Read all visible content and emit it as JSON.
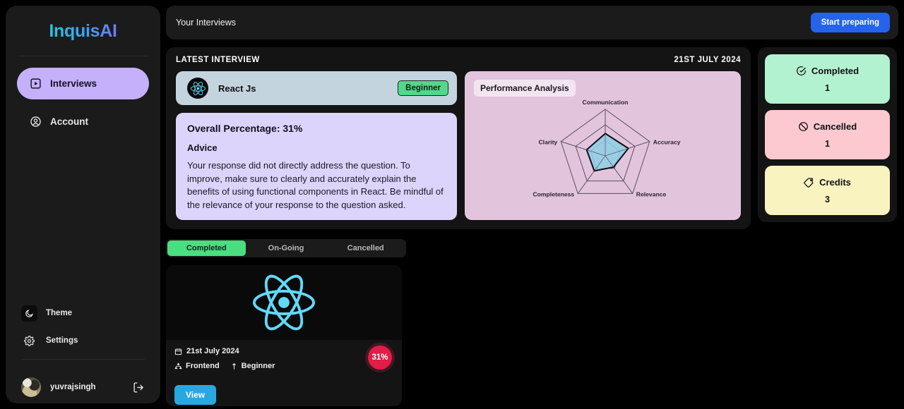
{
  "sidebar": {
    "logo": "InquisAI",
    "nav": [
      {
        "label": "Interviews",
        "icon": "play-square-icon",
        "active": true
      },
      {
        "label": "Account",
        "icon": "user-circle-icon",
        "active": false
      }
    ],
    "theme": {
      "label": "Theme",
      "icon": "moon-icon"
    },
    "settings": {
      "label": "Settings",
      "icon": "gear-icon"
    },
    "user": {
      "name": "yuvrajsingh",
      "logout_icon": "logout-icon",
      "avatar": "user-avatar"
    }
  },
  "header": {
    "title": "Your Interviews",
    "start_button": "Start preparing"
  },
  "latest": {
    "label": "LATEST INTERVIEW",
    "date": "21ST JULY 2024",
    "tech": {
      "name": "React Js",
      "icon": "react-icon",
      "level": "Beginner"
    },
    "overall": "Overall Percentage: 31%",
    "advice_heading": "Advice",
    "advice_text": "Your response did not directly address the question. To improve, make sure to clearly and accurately explain the benefits of using functional components in React. Be mindful of the relevance of your response to the question asked."
  },
  "chart_data": {
    "type": "radar",
    "title": "Performance Analysis",
    "categories": [
      "Communication",
      "Accuracy",
      "Relevance",
      "Completeness",
      "Clarity"
    ],
    "values": [
      0.48,
      0.52,
      0.3,
      0.4,
      0.42
    ],
    "rings": 3,
    "max": 1,
    "fill_color": "#8ecfe6",
    "stroke_color": "#0d0d14",
    "grid_color": "#5c4f63",
    "background": "#e2c5dd",
    "legend": "none"
  },
  "stats": [
    {
      "label": "Completed",
      "value": "1",
      "icon": "check-circle-icon",
      "color": "#b2f2d0"
    },
    {
      "label": "Cancelled",
      "value": "1",
      "icon": "ban-icon",
      "color": "#fbc9cf"
    },
    {
      "label": "Credits",
      "value": "3",
      "icon": "tag-icon",
      "color": "#f9f3c0"
    }
  ],
  "tabs": [
    {
      "label": "Completed",
      "active": true
    },
    {
      "label": "On-Going",
      "active": false
    },
    {
      "label": "Cancelled",
      "active": false
    }
  ],
  "interview_cards": [
    {
      "thumb_icon": "react-icon",
      "date": "21st July 2024",
      "date_icon": "calendar-icon",
      "role": "Frontend",
      "role_icon": "sitemap-icon",
      "level": "Beginner",
      "level_icon": "signal-icon",
      "percent": "31%",
      "view_label": "View"
    }
  ],
  "colors": {
    "accent_blue": "#2563eb",
    "nav_active": "#c4b0fb",
    "tab_active": "#4ade80",
    "badge_red": "#e11d48",
    "view_blue": "#29a8e0",
    "react_cyan": "#61dafb"
  }
}
